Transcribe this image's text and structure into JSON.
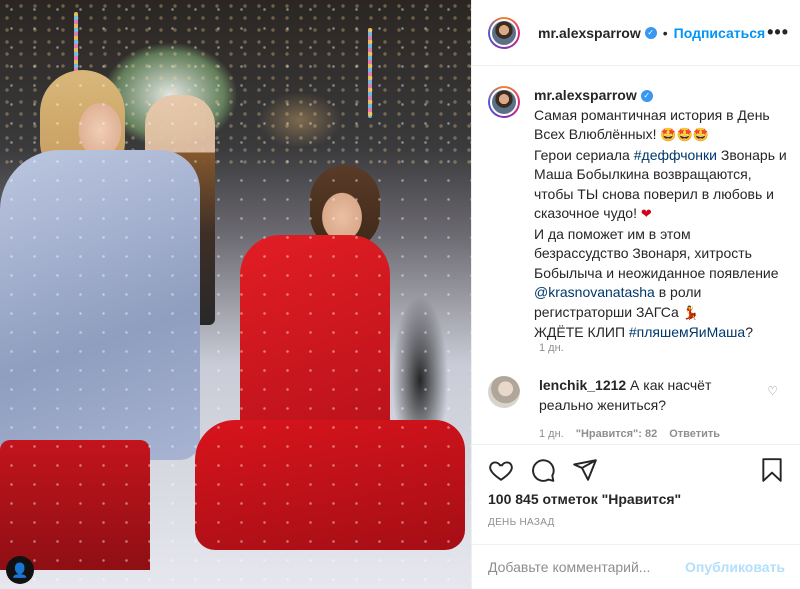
{
  "post": {
    "username": "mr.alexsparrow",
    "verified_icon": "verified-badge-icon",
    "follow_label": "Подписаться",
    "more_label": "•••",
    "dot": "•"
  },
  "caption": {
    "username": "mr.alexsparrow",
    "text_1": "Самая романтичная история в День Всех Влюблённых! ",
    "emojis_1": "🤩🤩🤩",
    "text_2": "Герои сериала ",
    "hashtag_1": "#деффчонки",
    "text_3": " Звонарь и Маша Бобылкина возвращаются, чтобы ТЫ снова поверил в любовь и сказочное чудо! ",
    "emoji_heart": "❤",
    "text_4": "И да поможет им в этом безрассудство Звонаря, хитрость Бобылыча и неожиданное появление ",
    "mention": "@krasnovanatasha",
    "text_5": " в роли регистраторши ЗАГСа ",
    "emoji_dancer": "💃",
    "text_6": "ЖДЁТЕ КЛИП ",
    "hashtag_2": "#пляшемЯиМаша",
    "text_7": "?",
    "time": "1 дн."
  },
  "comment": {
    "username": "lenchik_1212",
    "text": " А как насчёт реально жениться?",
    "time": "1 дн.",
    "likes": "\"Нравится\": 82",
    "reply": "Ответить",
    "heart_icon": "♡"
  },
  "actions": {
    "likes_text": "100 845 отметок \"Нравится\"",
    "ago": "ДЕНЬ НАЗАД"
  },
  "add_comment": {
    "placeholder": "Добавьте комментарий...",
    "post_label": "Опубликовать"
  },
  "photo": {
    "user_tag_icon": "👤"
  },
  "colors": {
    "link": "#00376b",
    "follow": "#0095f6",
    "post_disabled": "#b2dffc",
    "secondary": "#8e8e8e"
  }
}
